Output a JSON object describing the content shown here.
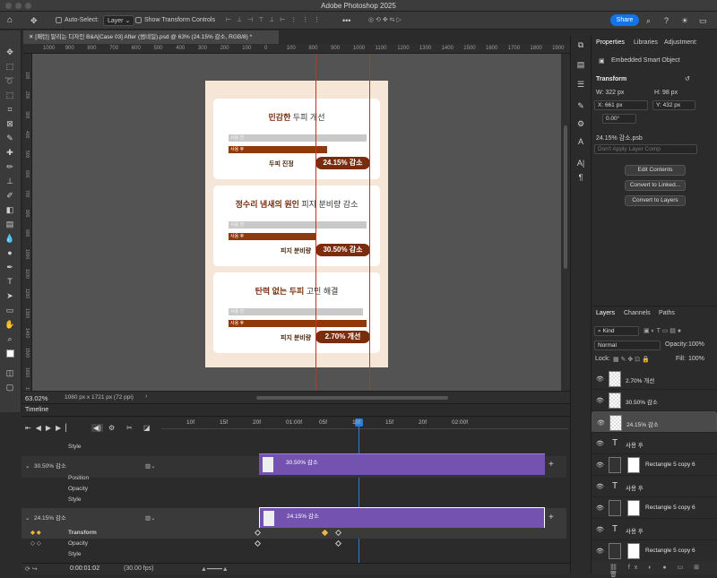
{
  "app": {
    "title": "Adobe Photoshop 2025"
  },
  "options": {
    "auto_select_label": "Auto-Select:",
    "auto_select_value": "Layer",
    "show_transform_label": "Show Transform Controls",
    "share_label": "Share"
  },
  "doc": {
    "tab_title": "[패턴] 말리는 디자인 B&A[Case 03] After (썸네일).psd @ 63% (24.15% 감소, RGB/8) *",
    "zoom": "63.02%",
    "size_info": "1080 px x 1721 px (72 ppi)"
  },
  "rulers": {
    "h": [
      "1000",
      "900",
      "800",
      "700",
      "600",
      "500",
      "400",
      "300",
      "200",
      "100",
      "0",
      "100",
      "800",
      "900",
      "1000",
      "1100",
      "1200",
      "1300",
      "1400",
      "1500",
      "1600",
      "1700",
      "1800",
      "1900",
      "2000"
    ],
    "v": [
      "100",
      "200",
      "300",
      "400",
      "500",
      "600",
      "700",
      "800",
      "900",
      "1000",
      "1100",
      "1200",
      "1300",
      "1400",
      "1500",
      "1600",
      "1700"
    ]
  },
  "poster": {
    "cards": [
      {
        "title_bold": "민감한",
        "title_rest": " 두피 개선",
        "before": "사용 전",
        "after": "사용 후",
        "metric": "두피 진정",
        "value": "24.15% 감소"
      },
      {
        "title_bold": "정수리 냄새의 원인",
        "title_rest": " 피지 분비량 감소",
        "before": "사용 전",
        "after": "사용 후",
        "metric": "피지 분비량",
        "value": "30.50% 감소"
      },
      {
        "title_bold": "탄력 없는 두피",
        "title_rest": " 고민 해결",
        "before": "사용 전",
        "after": "사용 후",
        "metric": "피지 분비량",
        "value": "2.70% 개선"
      }
    ]
  },
  "properties": {
    "tabs": [
      "Properties",
      "Libraries",
      "Adjustment:"
    ],
    "type": "Embedded Smart Object",
    "section": "Transform",
    "w": "W:  322 px",
    "h": "H:  98 px",
    "x": "X:  661 px",
    "y": "Y:  432 px",
    "angle": "0.00°",
    "file": "24.15% 감소.psb",
    "layer_comp": "Don't Apply Layer Comp",
    "edit_btn": "Edit Contents",
    "linked_btn": "Convert to Linked...",
    "layers_btn": "Convert to Layers"
  },
  "layers": {
    "tabs": [
      "Layers",
      "Channels",
      "Paths"
    ],
    "kind": "Kind",
    "blend": "Normal",
    "opacity_label": "Opacity:",
    "opacity": "100%",
    "lock_label": "Lock:",
    "fill_label": "Fill:",
    "fill": "100%",
    "items": [
      {
        "name": "2.70% 개선",
        "type": "smart"
      },
      {
        "name": "30.50% 감소",
        "type": "smart"
      },
      {
        "name": "24.15% 감소",
        "type": "smart"
      },
      {
        "name": "사용 후",
        "type": "text"
      },
      {
        "name": "Rectangle 5 copy 6",
        "type": "shape"
      },
      {
        "name": "사용 후",
        "type": "text"
      },
      {
        "name": "Rectangle 5 copy 6",
        "type": "shape"
      },
      {
        "name": "사용 후",
        "type": "text"
      },
      {
        "name": "Rectangle 5 copy 6",
        "type": "shape"
      }
    ]
  },
  "timeline": {
    "title": "Timeline",
    "ticks": [
      "10f",
      "15f",
      "20f",
      "01:00f",
      "05f",
      "10f",
      "15f",
      "20f",
      "02:00f"
    ],
    "tick_first": "10f",
    "time": "0:00:01:02",
    "fps": "(30.00 fps)",
    "tracks": [
      "Style",
      "30.50% 감소",
      "Position",
      "Opacity",
      "Style",
      "24.15% 감소",
      "Transform",
      "Opacity",
      "Style"
    ],
    "clip1": "30.50% 감소",
    "clip2": "24.15% 감소"
  }
}
